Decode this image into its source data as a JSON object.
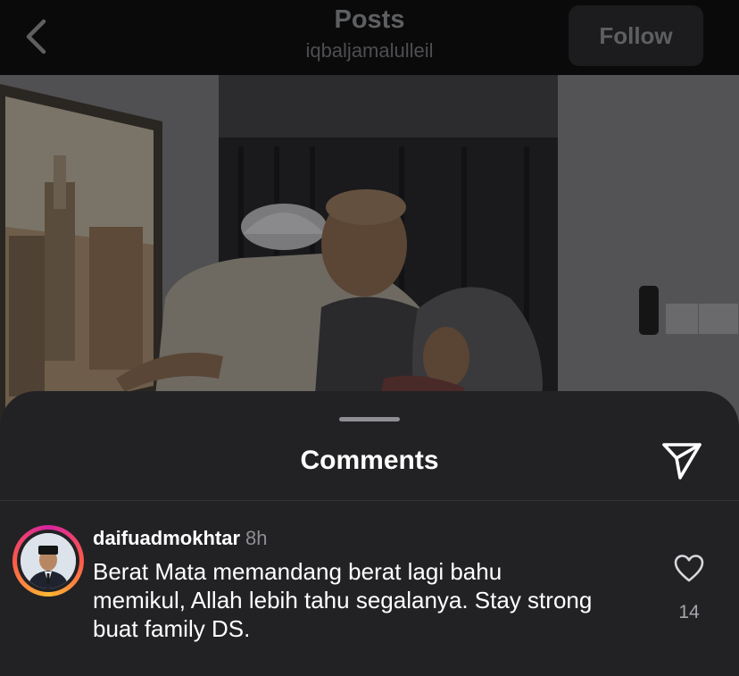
{
  "header": {
    "title": "Posts",
    "username": "iqbaljamalulleil",
    "follow_label": "Follow",
    "back_icon": "chevron-left-icon"
  },
  "comments_sheet": {
    "title": "Comments",
    "share_icon": "paper-plane-icon",
    "comments": [
      {
        "username": "daifuadmokhtar",
        "time": "8h",
        "text": "Berat Mata memandang berat lagi bahu memikul, Allah lebih tahu segalanya. Stay strong buat family DS.",
        "like_icon": "heart-outline-icon",
        "likes": "14"
      }
    ]
  },
  "colors": {
    "sheet_bg": "#222225",
    "topbar_bg": "#0a0a0b",
    "text_primary": "#ffffff",
    "text_secondary": "#8e8e93"
  }
}
